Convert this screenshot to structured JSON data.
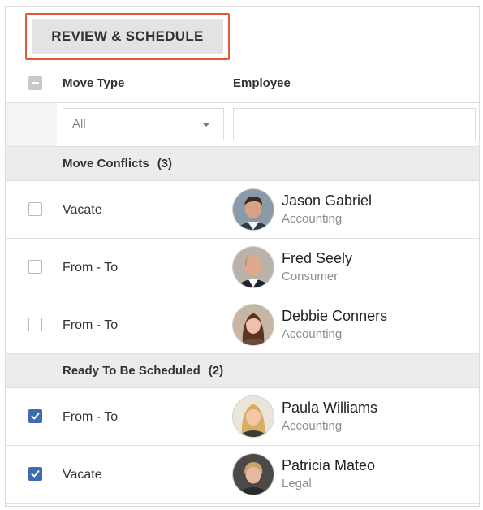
{
  "toolbar": {
    "review_button_label": "REVIEW & SCHEDULE"
  },
  "columns": {
    "move_type": "Move Type",
    "employee": "Employee"
  },
  "filters": {
    "move_type_selected": "All",
    "employee_value": ""
  },
  "groups": [
    {
      "label": "Move Conflicts",
      "count": "(3)",
      "rows": [
        {
          "checked": false,
          "move_type": "Vacate",
          "name": "Jason Gabriel",
          "department": "Accounting",
          "avatar": "male-dark-hair"
        },
        {
          "checked": false,
          "move_type": "From - To",
          "name": "Fred Seely",
          "department": "Consumer",
          "avatar": "male-bald"
        },
        {
          "checked": false,
          "move_type": "From - To",
          "name": "Debbie Conners",
          "department": "Accounting",
          "avatar": "female-brown-hair"
        }
      ]
    },
    {
      "label": "Ready To Be Scheduled",
      "count": "(2)",
      "rows": [
        {
          "checked": true,
          "move_type": "From - To",
          "name": "Paula Williams",
          "department": "Accounting",
          "avatar": "female-blonde"
        },
        {
          "checked": true,
          "move_type": "Vacate",
          "name": "Patricia Mateo",
          "department": "Legal",
          "avatar": "female-short-blonde"
        }
      ]
    }
  ],
  "colors": {
    "accent": "#e15a34",
    "checkbox_checked": "#3f6bb0",
    "group_bg": "#ececec"
  }
}
